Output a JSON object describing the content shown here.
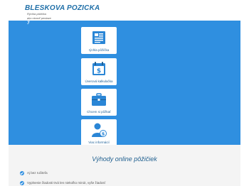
{
  "header": {
    "title": "BLESKOVA POZICKA",
    "tagline_1": "Rýchla pôžička",
    "tagline_2": "ako otvoriť peniaze"
  },
  "hero": {
    "text": "y"
  },
  "cards": [
    {
      "label": "rýchla pôžička",
      "icon": "document-icon"
    },
    {
      "label": "Úverová kalkulačka",
      "icon": "calendar-dollar-icon"
    },
    {
      "label": "Chcem si pôžkať",
      "icon": "briefcase-icon"
    },
    {
      "label": "Viac informácií",
      "icon": "person-dollar-icon"
    }
  ],
  "advantages_section": {
    "title": "Výhody online pôžičiek",
    "items": [
      "Aj bez ručiteľa",
      "Vyplnenie žiadosti trvá len niekoľko minút, vyše žiadosť"
    ]
  },
  "colors": {
    "brand": "#1f6fa8",
    "hero_bg": "#2f8fe0",
    "card_bg": "#ffffff",
    "icon_blue": "#2a86d6",
    "section_bg": "#f4f4f4"
  }
}
